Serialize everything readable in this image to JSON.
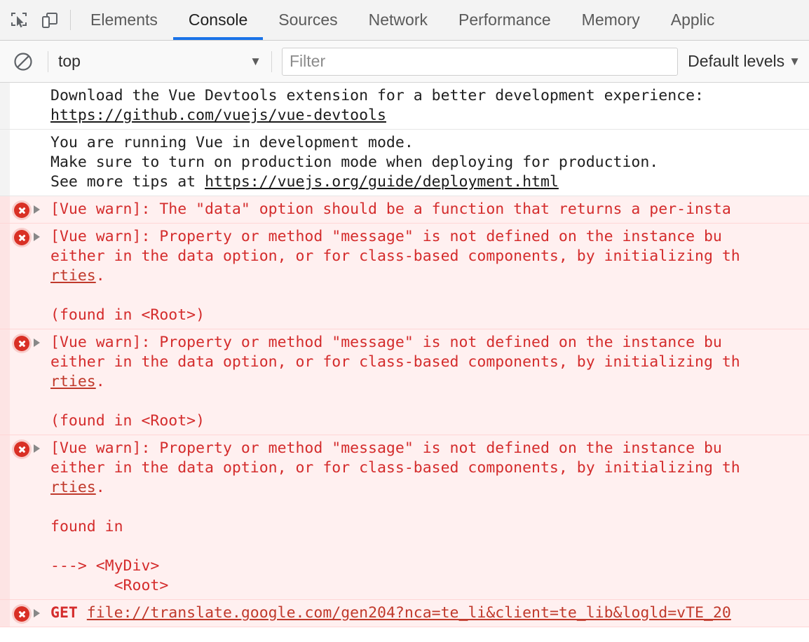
{
  "toolbar": {
    "inspect_icon": "inspect-element-icon",
    "device_icon": "device-toolbar-icon",
    "tabs": [
      {
        "label": "Elements",
        "active": false
      },
      {
        "label": "Console",
        "active": true
      },
      {
        "label": "Sources",
        "active": false
      },
      {
        "label": "Network",
        "active": false
      },
      {
        "label": "Performance",
        "active": false
      },
      {
        "label": "Memory",
        "active": false
      },
      {
        "label": "Applic",
        "active": false
      }
    ],
    "accent_color": "#1a73e8"
  },
  "filterbar": {
    "clear_icon": "clear-console-icon",
    "context": "top",
    "context_caret": "▼",
    "filter_placeholder": "Filter",
    "filter_value": "",
    "levels_label": "Default levels",
    "levels_caret": "▼"
  },
  "console": {
    "error_color": "#d42c2c",
    "error_background": "#fff0f0",
    "messages": [
      {
        "type": "log",
        "lines": [
          {
            "segments": [
              {
                "text": "Download the Vue Devtools extension for a better development experience:",
                "link": false
              }
            ]
          },
          {
            "segments": [
              {
                "text": "https://github.com/vuejs/vue-devtools",
                "link": true
              }
            ]
          }
        ]
      },
      {
        "type": "log",
        "lines": [
          {
            "segments": [
              {
                "text": "You are running Vue in development mode.",
                "link": false
              }
            ]
          },
          {
            "segments": [
              {
                "text": "Make sure to turn on production mode when deploying for production.",
                "link": false
              }
            ]
          },
          {
            "segments": [
              {
                "text": "See more tips at ",
                "link": false
              },
              {
                "text": "https://vuejs.org/guide/deployment.html",
                "link": true
              }
            ]
          }
        ]
      },
      {
        "type": "error",
        "lines": [
          {
            "segments": [
              {
                "text": "[Vue warn]: The \"data\" option should be a function that returns a per-insta",
                "link": false
              }
            ]
          }
        ]
      },
      {
        "type": "error",
        "lines": [
          {
            "segments": [
              {
                "text": "[Vue warn]: Property or method \"message\" is not defined on the instance bu",
                "link": false
              }
            ]
          },
          {
            "segments": [
              {
                "text": "either in the data option, or for class-based components, by initializing th",
                "link": false
              }
            ]
          },
          {
            "segments": [
              {
                "text": "rties",
                "link": true
              },
              {
                "text": ".",
                "link": false
              }
            ]
          },
          {
            "blank": true
          },
          {
            "segments": [
              {
                "text": "(found in <Root>)",
                "link": false
              }
            ]
          }
        ]
      },
      {
        "type": "error",
        "lines": [
          {
            "segments": [
              {
                "text": "[Vue warn]: Property or method \"message\" is not defined on the instance bu",
                "link": false
              }
            ]
          },
          {
            "segments": [
              {
                "text": "either in the data option, or for class-based components, by initializing th",
                "link": false
              }
            ]
          },
          {
            "segments": [
              {
                "text": "rties",
                "link": true
              },
              {
                "text": ".",
                "link": false
              }
            ]
          },
          {
            "blank": true
          },
          {
            "segments": [
              {
                "text": "(found in <Root>)",
                "link": false
              }
            ]
          }
        ]
      },
      {
        "type": "error",
        "lines": [
          {
            "segments": [
              {
                "text": "[Vue warn]: Property or method \"message\" is not defined on the instance bu",
                "link": false
              }
            ]
          },
          {
            "segments": [
              {
                "text": "either in the data option, or for class-based components, by initializing th",
                "link": false
              }
            ]
          },
          {
            "segments": [
              {
                "text": "rties",
                "link": true
              },
              {
                "text": ".",
                "link": false
              }
            ]
          },
          {
            "blank": true
          },
          {
            "segments": [
              {
                "text": "found in",
                "link": false
              }
            ]
          },
          {
            "blank": true
          },
          {
            "segments": [
              {
                "text": "---> <MyDiv>",
                "link": false
              }
            ]
          },
          {
            "segments": [
              {
                "text": "       <Root>",
                "link": false
              }
            ]
          }
        ]
      },
      {
        "type": "error",
        "lines": [
          {
            "segments": [
              {
                "text": "GET",
                "link": false,
                "bold": true
              },
              {
                "text": " ",
                "link": false
              },
              {
                "text": "file://translate.google.com/gen204?nca=te_li&client=te_lib&logld=vTE_20",
                "link": true
              }
            ]
          }
        ]
      }
    ]
  }
}
